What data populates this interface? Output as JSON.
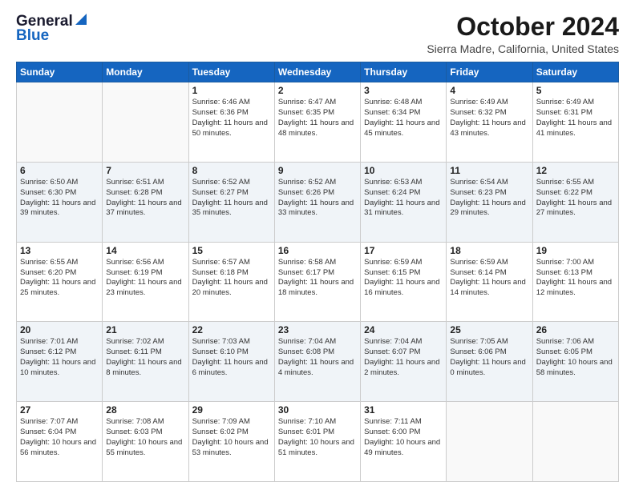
{
  "header": {
    "logo_general": "General",
    "logo_blue": "Blue",
    "month_title": "October 2024",
    "location": "Sierra Madre, California, United States"
  },
  "days_of_week": [
    "Sunday",
    "Monday",
    "Tuesday",
    "Wednesday",
    "Thursday",
    "Friday",
    "Saturday"
  ],
  "weeks": [
    [
      {
        "day": "",
        "data": ""
      },
      {
        "day": "",
        "data": ""
      },
      {
        "day": "1",
        "data": "Sunrise: 6:46 AM\nSunset: 6:36 PM\nDaylight: 11 hours and 50 minutes."
      },
      {
        "day": "2",
        "data": "Sunrise: 6:47 AM\nSunset: 6:35 PM\nDaylight: 11 hours and 48 minutes."
      },
      {
        "day": "3",
        "data": "Sunrise: 6:48 AM\nSunset: 6:34 PM\nDaylight: 11 hours and 45 minutes."
      },
      {
        "day": "4",
        "data": "Sunrise: 6:49 AM\nSunset: 6:32 PM\nDaylight: 11 hours and 43 minutes."
      },
      {
        "day": "5",
        "data": "Sunrise: 6:49 AM\nSunset: 6:31 PM\nDaylight: 11 hours and 41 minutes."
      }
    ],
    [
      {
        "day": "6",
        "data": "Sunrise: 6:50 AM\nSunset: 6:30 PM\nDaylight: 11 hours and 39 minutes."
      },
      {
        "day": "7",
        "data": "Sunrise: 6:51 AM\nSunset: 6:28 PM\nDaylight: 11 hours and 37 minutes."
      },
      {
        "day": "8",
        "data": "Sunrise: 6:52 AM\nSunset: 6:27 PM\nDaylight: 11 hours and 35 minutes."
      },
      {
        "day": "9",
        "data": "Sunrise: 6:52 AM\nSunset: 6:26 PM\nDaylight: 11 hours and 33 minutes."
      },
      {
        "day": "10",
        "data": "Sunrise: 6:53 AM\nSunset: 6:24 PM\nDaylight: 11 hours and 31 minutes."
      },
      {
        "day": "11",
        "data": "Sunrise: 6:54 AM\nSunset: 6:23 PM\nDaylight: 11 hours and 29 minutes."
      },
      {
        "day": "12",
        "data": "Sunrise: 6:55 AM\nSunset: 6:22 PM\nDaylight: 11 hours and 27 minutes."
      }
    ],
    [
      {
        "day": "13",
        "data": "Sunrise: 6:55 AM\nSunset: 6:20 PM\nDaylight: 11 hours and 25 minutes."
      },
      {
        "day": "14",
        "data": "Sunrise: 6:56 AM\nSunset: 6:19 PM\nDaylight: 11 hours and 23 minutes."
      },
      {
        "day": "15",
        "data": "Sunrise: 6:57 AM\nSunset: 6:18 PM\nDaylight: 11 hours and 20 minutes."
      },
      {
        "day": "16",
        "data": "Sunrise: 6:58 AM\nSunset: 6:17 PM\nDaylight: 11 hours and 18 minutes."
      },
      {
        "day": "17",
        "data": "Sunrise: 6:59 AM\nSunset: 6:15 PM\nDaylight: 11 hours and 16 minutes."
      },
      {
        "day": "18",
        "data": "Sunrise: 6:59 AM\nSunset: 6:14 PM\nDaylight: 11 hours and 14 minutes."
      },
      {
        "day": "19",
        "data": "Sunrise: 7:00 AM\nSunset: 6:13 PM\nDaylight: 11 hours and 12 minutes."
      }
    ],
    [
      {
        "day": "20",
        "data": "Sunrise: 7:01 AM\nSunset: 6:12 PM\nDaylight: 11 hours and 10 minutes."
      },
      {
        "day": "21",
        "data": "Sunrise: 7:02 AM\nSunset: 6:11 PM\nDaylight: 11 hours and 8 minutes."
      },
      {
        "day": "22",
        "data": "Sunrise: 7:03 AM\nSunset: 6:10 PM\nDaylight: 11 hours and 6 minutes."
      },
      {
        "day": "23",
        "data": "Sunrise: 7:04 AM\nSunset: 6:08 PM\nDaylight: 11 hours and 4 minutes."
      },
      {
        "day": "24",
        "data": "Sunrise: 7:04 AM\nSunset: 6:07 PM\nDaylight: 11 hours and 2 minutes."
      },
      {
        "day": "25",
        "data": "Sunrise: 7:05 AM\nSunset: 6:06 PM\nDaylight: 11 hours and 0 minutes."
      },
      {
        "day": "26",
        "data": "Sunrise: 7:06 AM\nSunset: 6:05 PM\nDaylight: 10 hours and 58 minutes."
      }
    ],
    [
      {
        "day": "27",
        "data": "Sunrise: 7:07 AM\nSunset: 6:04 PM\nDaylight: 10 hours and 56 minutes."
      },
      {
        "day": "28",
        "data": "Sunrise: 7:08 AM\nSunset: 6:03 PM\nDaylight: 10 hours and 55 minutes."
      },
      {
        "day": "29",
        "data": "Sunrise: 7:09 AM\nSunset: 6:02 PM\nDaylight: 10 hours and 53 minutes."
      },
      {
        "day": "30",
        "data": "Sunrise: 7:10 AM\nSunset: 6:01 PM\nDaylight: 10 hours and 51 minutes."
      },
      {
        "day": "31",
        "data": "Sunrise: 7:11 AM\nSunset: 6:00 PM\nDaylight: 10 hours and 49 minutes."
      },
      {
        "day": "",
        "data": ""
      },
      {
        "day": "",
        "data": ""
      }
    ]
  ]
}
